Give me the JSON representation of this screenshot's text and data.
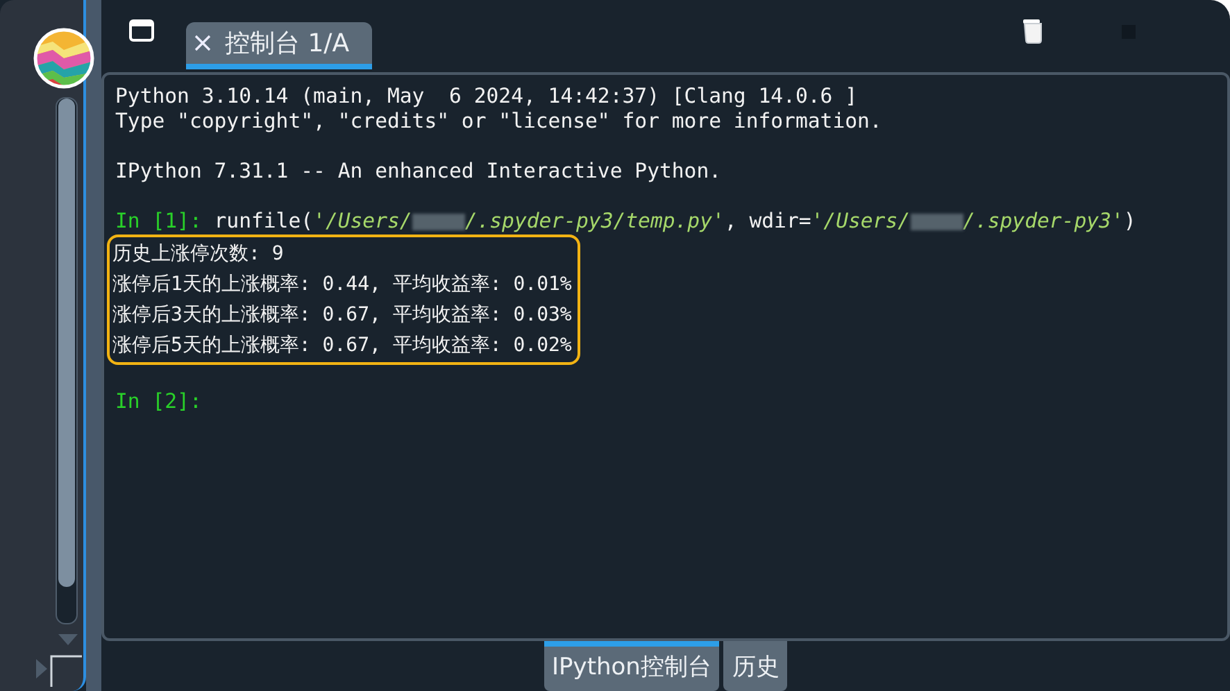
{
  "console_tabs": [
    {
      "label": "控制台 1/A",
      "selected": true
    }
  ],
  "console": {
    "lines": [
      {
        "kind": "plain",
        "text": "Python 3.10.14 (main, May  6 2024, 14:42:37) [Clang 14.0.6 ]"
      },
      {
        "kind": "plain",
        "text": "Type \"copyright\", \"credits\" or \"license\" for more information."
      },
      {
        "kind": "blank"
      },
      {
        "kind": "plain",
        "text": "IPython 7.31.1 -- An enhanced Interactive Python."
      },
      {
        "kind": "blank"
      },
      {
        "kind": "input",
        "prompt": "In [1]:",
        "segments": [
          {
            "kind": "code",
            "text": " runfile("
          },
          {
            "kind": "string",
            "text": "'/Users/"
          },
          {
            "kind": "redacted"
          },
          {
            "kind": "string",
            "text": "/.spyder-py3/temp.py'"
          },
          {
            "kind": "code",
            "text": ", wdir="
          },
          {
            "kind": "string",
            "text": "'/Users/"
          },
          {
            "kind": "redacted"
          },
          {
            "kind": "string",
            "text": "/.spyder-py3'"
          },
          {
            "kind": "code",
            "text": ")"
          }
        ]
      },
      {
        "kind": "output",
        "highlighted": true,
        "text": "历史上涨停次数: 9"
      },
      {
        "kind": "output",
        "highlighted": true,
        "text": "涨停后1天的上涨概率: 0.44, 平均收益率: 0.01%"
      },
      {
        "kind": "output",
        "highlighted": true,
        "text": "涨停后3天的上涨概率: 0.67, 平均收益率: 0.03%"
      },
      {
        "kind": "output",
        "highlighted": true,
        "text": "涨停后5天的上涨概率: 0.67, 平均收益率: 0.02%"
      },
      {
        "kind": "blank"
      },
      {
        "kind": "input",
        "prompt": "In [2]:"
      }
    ]
  },
  "pane_tabs": [
    {
      "label": "IPython控制台",
      "selected": true
    },
    {
      "label": "历史",
      "selected": false
    }
  ]
}
